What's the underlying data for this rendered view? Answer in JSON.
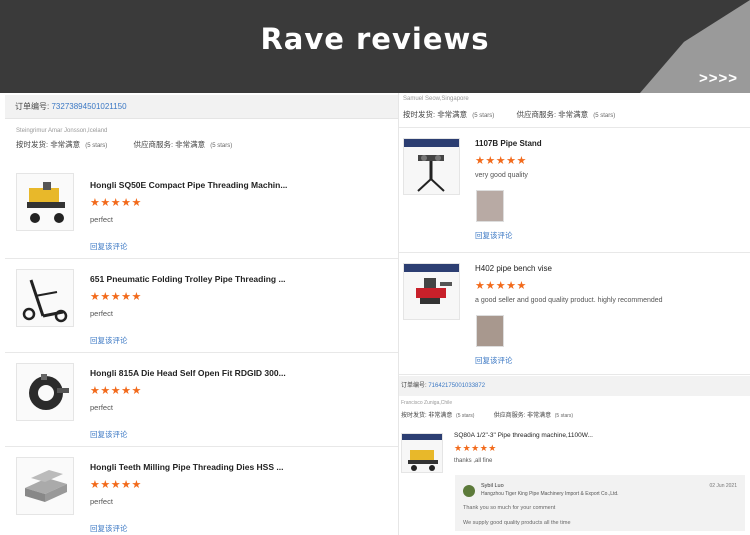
{
  "banner": {
    "title": "Rave reviews",
    "more": ">>>>"
  },
  "left": {
    "order_label": "订单编号:",
    "order_number": "73273894501021150",
    "buyer": "Steingrimur Amar Jonsson,Iceland",
    "ship_label": "按时发货:",
    "ship_value": "非常满意",
    "ship_stars": "(5 stars)",
    "service_label": "供应商服务:",
    "service_value": "非常满意",
    "service_stars": "(5 stars)",
    "items": [
      {
        "title": "Hongli SQ50E Compact Pipe Threading Machin...",
        "stars": "★★★★★",
        "text": "perfect",
        "reply": "回复该评论"
      },
      {
        "title": "651 Pneumatic Folding Trolley Pipe Threading ...",
        "stars": "★★★★★",
        "text": "perfect",
        "reply": "回复该评论"
      },
      {
        "title": "Hongli 815A Die Head Self Open Fit RDGID 300...",
        "stars": "★★★★★",
        "text": "perfect",
        "reply": "回复该评论"
      },
      {
        "title": "Hongli Teeth Milling Pipe Threading Dies HSS ...",
        "stars": "★★★★★",
        "text": "perfect",
        "reply": "回复该评论"
      }
    ]
  },
  "right": {
    "buyer": "Samuel Seow,Singapore",
    "ship_label": "按时发货:",
    "ship_value": "非常满意",
    "ship_stars": "(5 stars)",
    "service_label": "供应商服务:",
    "service_value": "非常满意",
    "service_stars": "(5 stars)",
    "items": [
      {
        "title": "1107B Pipe Stand",
        "stars": "★★★★★",
        "text": "very good quality",
        "reply": "回复该评论"
      },
      {
        "title": "H402 pipe bench vise",
        "stars": "★★★★★",
        "text": "a good seller and good quality product.  highly recommended",
        "reply": "回复该评论"
      }
    ],
    "order2": {
      "order_label": "订单编号:",
      "order_number": "71642175001033872",
      "buyer": "Francisco Zuniga,Chile",
      "ship_label": "按时发货:",
      "ship_value": "非常满意",
      "ship_stars": "(5 stars)",
      "service_label": "供应商服务:",
      "service_value": "非常满意",
      "service_stars": "(5 stars)",
      "item": {
        "title": "SQ80A 1/2\"-3\" Pipe threading machine,1100W...",
        "stars": "★★★★★",
        "text": "thanks ,all fine"
      },
      "seller_reply": {
        "name": "Sybil Luo",
        "company": "Hangzhou Tiger King Pipe Machinery Import & Export Co.,Ltd.",
        "date": "02 Jun 2021",
        "line1": "Thank you so much for your comment",
        "line2": "We supply good quality products all the time"
      }
    }
  },
  "colors": {
    "accent": "#f26a1b",
    "link": "#3b78c4",
    "banner": "#3a3a3a"
  }
}
